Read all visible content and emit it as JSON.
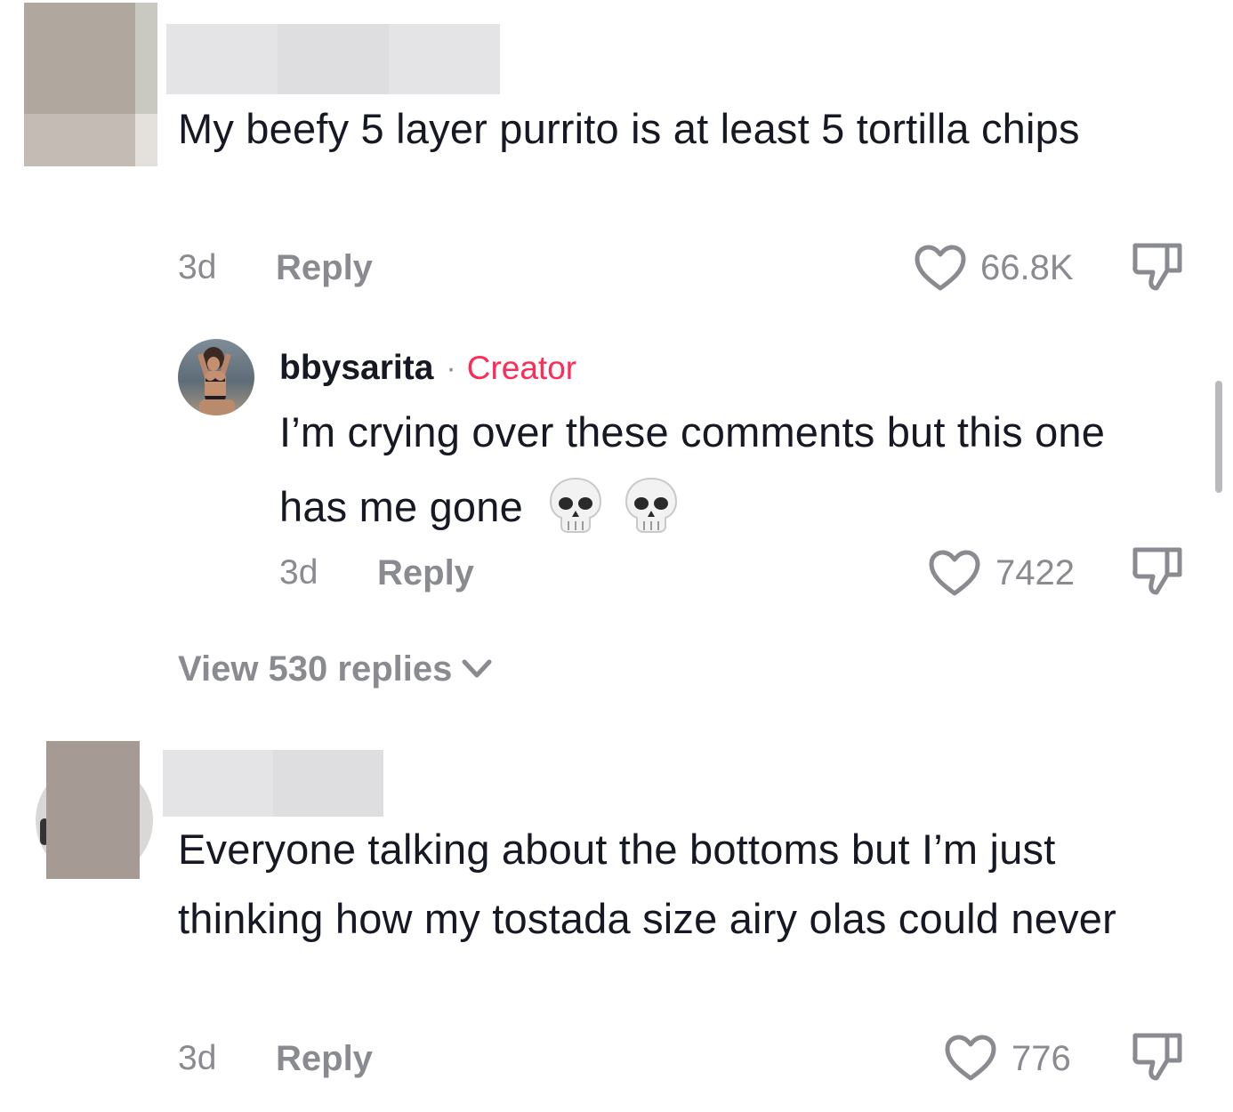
{
  "comments": [
    {
      "text": "My beefy 5 layer purrito is at least 5 tortilla chips",
      "time": "3d",
      "reply_label": "Reply",
      "likes": "66.8K"
    },
    {
      "text": "Everyone talking about the bottoms but I’m just thinking how my tostada size airy olas could never",
      "time": "3d",
      "reply_label": "Reply",
      "likes": "776"
    }
  ],
  "reply": {
    "username": "bbysarita",
    "separator": "·",
    "badge": "Creator",
    "text": "I’m crying over these comments but this one has me gone",
    "emojis": [
      "💀",
      "💀"
    ],
    "time": "3d",
    "reply_label": "Reply",
    "likes": "7422"
  },
  "view_replies": "View 530 replies",
  "colors": {
    "text": "#161823",
    "muted": "#8a8b91",
    "creator": "#fe2c55",
    "redaction": "#e2e2e4"
  },
  "icons": [
    "heart-icon",
    "dislike-icon",
    "chevron-down-icon",
    "skull-emoji"
  ]
}
